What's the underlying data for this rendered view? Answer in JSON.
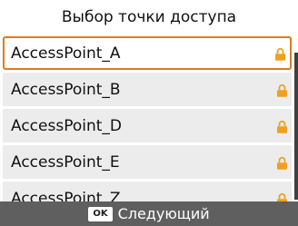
{
  "title": "Выбор точки доступа",
  "access_points": [
    {
      "name": "AccessPoint_A",
      "selected": true,
      "icon": "lock-icon"
    },
    {
      "name": "AccessPoint_B",
      "selected": false,
      "icon": "lock-icon"
    },
    {
      "name": "AccessPoint_D",
      "selected": false,
      "icon": "lock-icon"
    },
    {
      "name": "AccessPoint_E",
      "selected": false,
      "icon": "lock-icon"
    },
    {
      "name": "AccessPoint_Z",
      "selected": false,
      "icon": "lock-icon"
    }
  ],
  "footer": {
    "ok_label": "OK",
    "next_label": "Следующий"
  },
  "colors": {
    "accent": "#e07a1e",
    "lock": "#f0a020",
    "footer_bg": "#5f5f5f",
    "row_bg": "#ececec"
  }
}
